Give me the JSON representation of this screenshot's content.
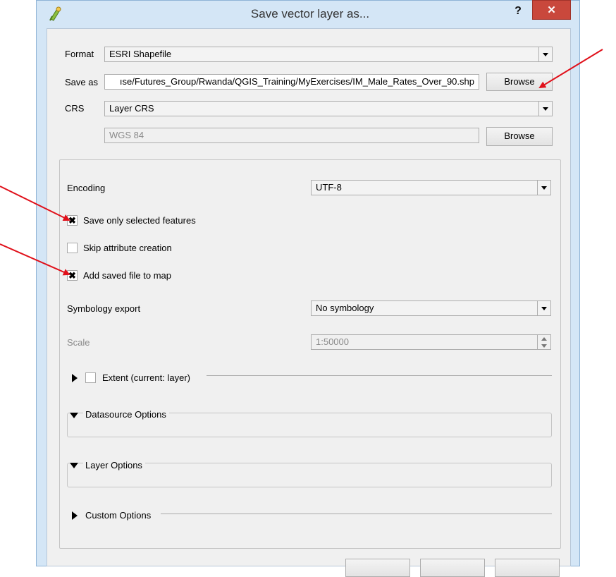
{
  "window": {
    "title": "Save vector layer as...",
    "help_label": "?",
    "close_label": "✕"
  },
  "form": {
    "format_label": "Format",
    "format_value": "ESRI Shapefile",
    "save_as_label": "Save as",
    "save_as_value": "ıse/Futures_Group/Rwanda/QGIS_Training/MyExercises/IM_Male_Rates_Over_90.shp",
    "browse_label": "Browse",
    "crs_label": "CRS",
    "crs_value": "Layer CRS",
    "crs_name": "WGS 84",
    "browse2_label": "Browse"
  },
  "options": {
    "encoding_label": "Encoding",
    "encoding_value": "UTF-8",
    "save_selected_label": "Save only selected features",
    "save_selected_checked": "✖",
    "skip_attr_label": "Skip attribute creation",
    "add_to_map_label": "Add saved file to map",
    "add_to_map_checked": "✖",
    "symbology_label": "Symbology export",
    "symbology_value": "No symbology",
    "scale_label": "Scale",
    "scale_value": "1:50000",
    "extent_label": "Extent (current: layer)",
    "datasource_label": "Datasource Options",
    "layer_options_label": "Layer Options",
    "custom_options_label": "Custom Options"
  },
  "colors": {
    "annotation_arrow": "#e0101a",
    "close_button": "#c9483c"
  }
}
